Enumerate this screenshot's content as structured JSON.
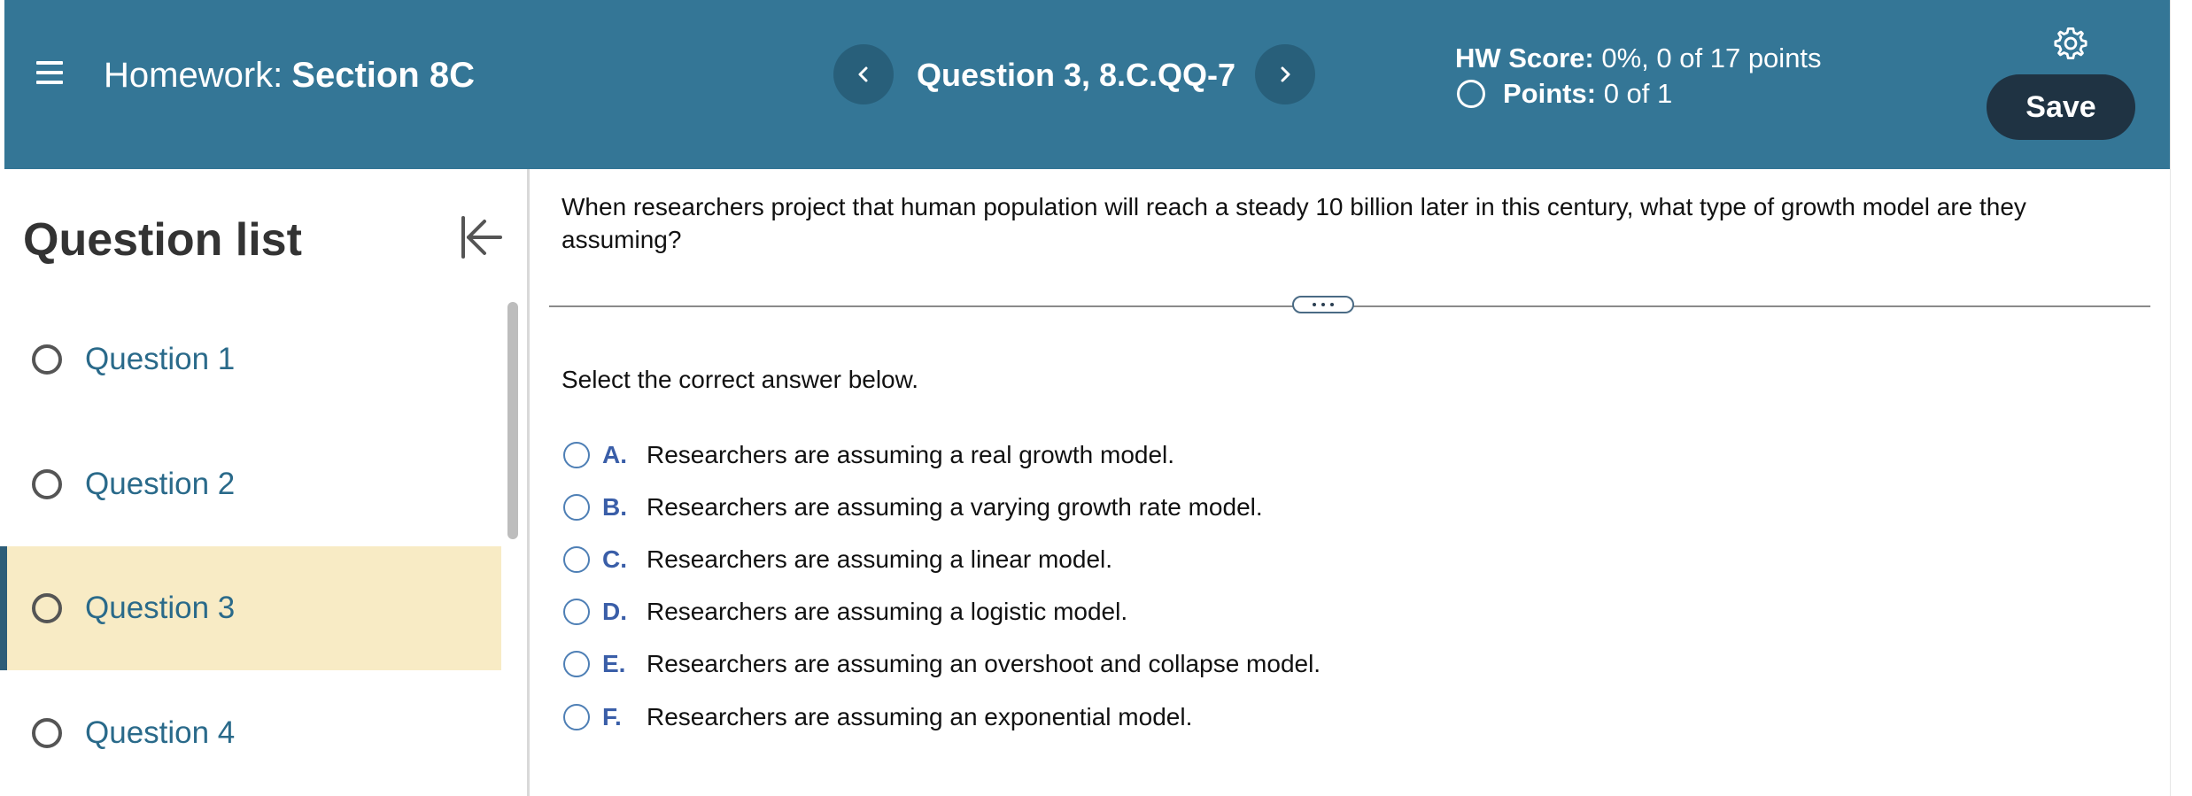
{
  "header": {
    "menu_icon": "hamburger-menu-icon",
    "homework_label": "Homework:",
    "section_title": "Section 8C",
    "question_title": "Question 3, 8.C.QQ-7",
    "hw_score_label": "HW Score:",
    "hw_score_value": "0%, 0 of 17 points",
    "points_label": "Points:",
    "points_value": "0 of 1",
    "save_label": "Save",
    "settings_icon": "gear-icon",
    "prev_icon": "chevron-left-icon",
    "next_icon": "chevron-right-icon"
  },
  "sidebar": {
    "title": "Question list",
    "collapse_icon": "collapse-left-icon",
    "items": [
      {
        "label": "Question 1",
        "active": false
      },
      {
        "label": "Question 2",
        "active": false
      },
      {
        "label": "Question 3",
        "active": true
      },
      {
        "label": "Question 4",
        "active": false
      }
    ]
  },
  "main": {
    "question_text": "When researchers project that human population will reach a steady 10 billion later in this century, what type of growth model are they assuming?",
    "instruction": "Select the correct answer below.",
    "options": [
      {
        "letter": "A.",
        "text": "Researchers are assuming a real growth model."
      },
      {
        "letter": "B.",
        "text": "Researchers are assuming a varying growth rate model."
      },
      {
        "letter": "C.",
        "text": "Researchers are assuming a linear model."
      },
      {
        "letter": "D.",
        "text": "Researchers are assuming a logistic model."
      },
      {
        "letter": "E.",
        "text": "Researchers are assuming an overshoot and collapse model."
      },
      {
        "letter": "F.",
        "text": "Researchers are assuming an exponential model."
      }
    ]
  },
  "colors": {
    "header_bg": "#347696",
    "save_button_bg": "#1f3343",
    "active_item_bg": "#f8ebc5",
    "option_letter": "#3a5ea8"
  }
}
